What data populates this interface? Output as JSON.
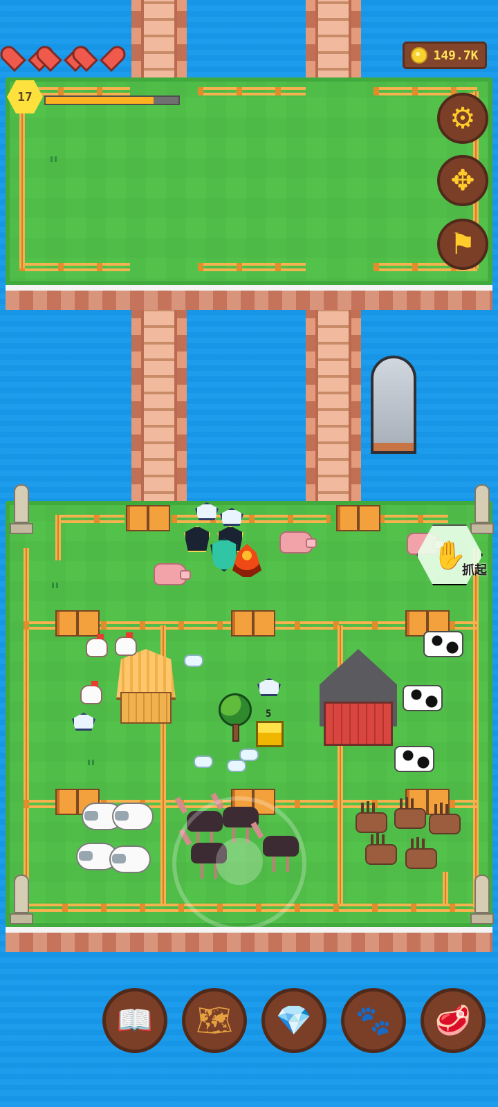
{
  "hud": {
    "coins": "149.7K",
    "level": "17",
    "xp_progress_percent": 81,
    "hearts": 3
  },
  "controls": {
    "pickup_label": "抓起",
    "chest_count": "5"
  },
  "icons": {
    "settings": "gear-icon",
    "move": "move-arrows-icon",
    "flag": "flag-icon",
    "book": "book-icon",
    "map": "map-scroll-icon",
    "gems": "gem-coin-icon",
    "paw": "paw-icon",
    "meat": "meat-icon"
  }
}
